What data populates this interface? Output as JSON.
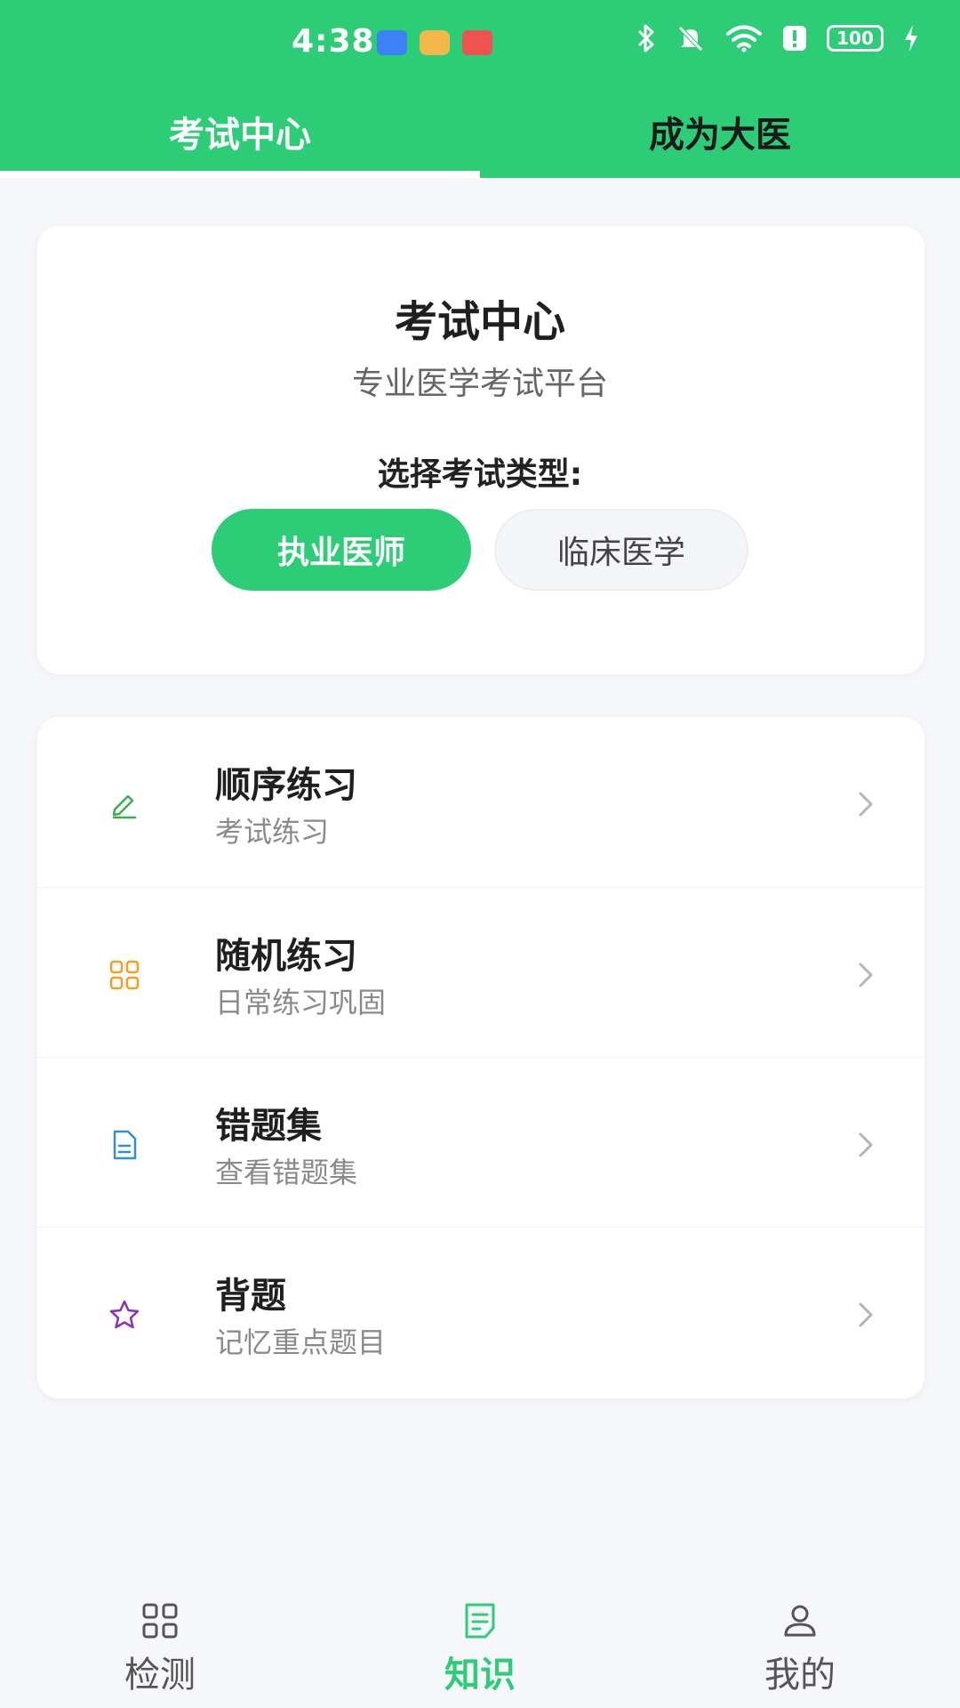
{
  "status_bar": {
    "time": "4:38",
    "battery": "100"
  },
  "top_tabs": [
    {
      "label": "考试中心",
      "active": true
    },
    {
      "label": "成为大医",
      "active": false
    }
  ],
  "exam_card": {
    "title": "考试中心",
    "subtitle": "专业医学考试平台",
    "type_label": "选择考试类型:",
    "types": [
      {
        "label": "执业医师",
        "selected": true
      },
      {
        "label": "临床医学",
        "selected": false
      }
    ]
  },
  "practice_list": [
    {
      "title": "顺序练习",
      "subtitle": "考试练习",
      "icon": "pencil-icon",
      "icon_color": "#3fae4a"
    },
    {
      "title": "随机练习",
      "subtitle": "日常练习巩固",
      "icon": "grid-icon",
      "icon_color": "#f0a020"
    },
    {
      "title": "错题集",
      "subtitle": "查看错题集",
      "icon": "document-icon",
      "icon_color": "#2f8fd8"
    },
    {
      "title": "背题",
      "subtitle": "记忆重点题目",
      "icon": "star-icon",
      "icon_color": "#8e2fb8"
    }
  ],
  "bottom_nav": [
    {
      "label": "检测",
      "icon": "grid-icon",
      "active": false
    },
    {
      "label": "知识",
      "icon": "document-icon",
      "active": true
    },
    {
      "label": "我的",
      "icon": "user-icon",
      "active": false
    }
  ],
  "colors": {
    "brand_green": "#2dcd78",
    "background": "#f6f7fa"
  }
}
